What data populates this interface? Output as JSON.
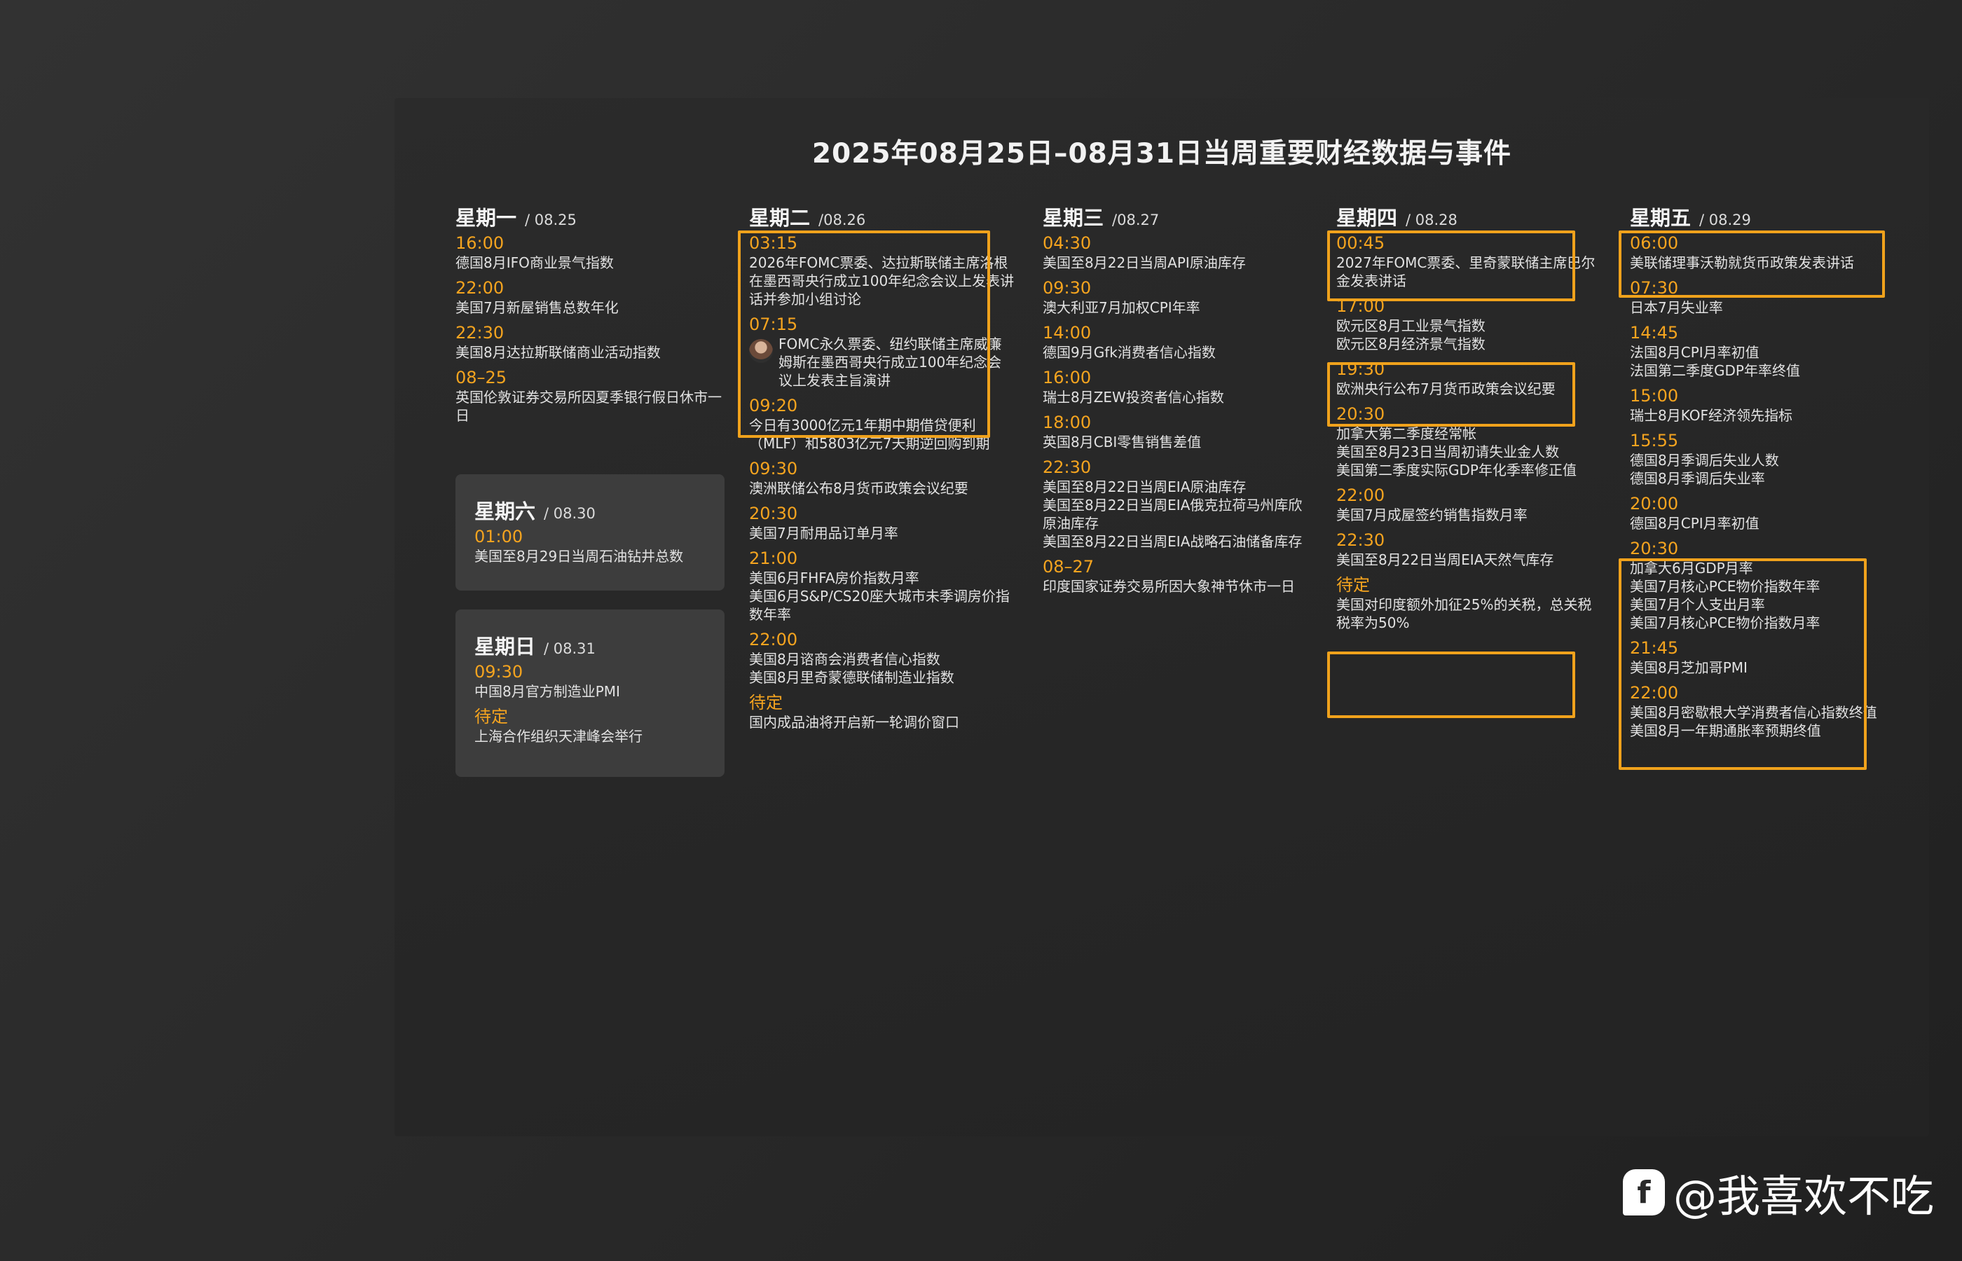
{
  "title": "2025年08月25日–08月31日当周重要财经数据与事件",
  "accent_color": "#f5a41f",
  "box_color": "#f0a21c",
  "days": {
    "mon": {
      "name": "星期一",
      "date": "/ 08.25",
      "events": [
        {
          "time": "16:00",
          "desc": [
            "德国8月IFO商业景气指数"
          ]
        },
        {
          "time": "22:00",
          "desc": [
            "美国7月新屋销售总数年化"
          ]
        },
        {
          "time": "22:30",
          "desc": [
            "美国8月达拉斯联储商业活动指数"
          ]
        },
        {
          "time": "08–25",
          "desc": [
            "英国伦敦证券交易所因夏季银行假日休市一日"
          ]
        }
      ]
    },
    "tue": {
      "name": "星期二",
      "date": "/08.26",
      "events": [
        {
          "time": "03:15",
          "desc": [
            "2026年FOMC票委、达拉斯联储主席洛根在墨西哥央行成立100年纪念会议上发表讲话并参加小组讨论"
          ]
        },
        {
          "time": "07:15",
          "desc": [
            "FOMC永久票委、纽约联储主席威廉姆斯在墨西哥央行成立100年纪念会议上发表主旨演讲"
          ]
        },
        {
          "time": "09:20",
          "desc": [
            "今日有3000亿元1年期中期借贷便利（MLF）和5803亿元7天期逆回购到期"
          ]
        },
        {
          "time": "09:30",
          "desc": [
            "澳洲联储公布8月货币政策会议纪要"
          ]
        },
        {
          "time": "20:30",
          "desc": [
            "美国7月耐用品订单月率"
          ]
        },
        {
          "time": "21:00",
          "desc": [
            "美国6月FHFA房价指数月率",
            "美国6月S&P/CS20座大城市未季调房价指数年率"
          ]
        },
        {
          "time": "22:00",
          "desc": [
            "美国8月谘商会消费者信心指数",
            "美国8月里奇蒙德联储制造业指数"
          ]
        },
        {
          "time": "待定",
          "desc": [
            "国内成品油将开启新一轮调价窗口"
          ]
        }
      ]
    },
    "wed": {
      "name": "星期三",
      "date": "/08.27",
      "events": [
        {
          "time": "04:30",
          "desc": [
            "美国至8月22日当周API原油库存"
          ]
        },
        {
          "time": "09:30",
          "desc": [
            "澳大利亚7月加权CPI年率"
          ]
        },
        {
          "time": "14:00",
          "desc": [
            "德国9月Gfk消费者信心指数"
          ]
        },
        {
          "time": "16:00",
          "desc": [
            "瑞士8月ZEW投资者信心指数"
          ]
        },
        {
          "time": "18:00",
          "desc": [
            "英国8月CBI零售销售差值"
          ]
        },
        {
          "time": "22:30",
          "desc": [
            "美国至8月22日当周EIA原油库存",
            "美国至8月22日当周EIA俄克拉荷马州库欣原油库存",
            "美国至8月22日当周EIA战略石油储备库存"
          ]
        },
        {
          "time": "08–27",
          "desc": [
            "印度国家证券交易所因大象神节休市一日"
          ]
        }
      ]
    },
    "thu": {
      "name": "星期四",
      "date": "/ 08.28",
      "events": [
        {
          "time": "00:45",
          "desc": [
            "2027年FOMC票委、里奇蒙联储主席巴尔金发表讲话"
          ]
        },
        {
          "time": "17:00",
          "desc": [
            "欧元区8月工业景气指数",
            "欧元区8月经济景气指数"
          ]
        },
        {
          "time": "19:30",
          "desc": [
            "欧洲央行公布7月货币政策会议纪要"
          ]
        },
        {
          "time": "20:30",
          "desc": [
            "加拿大第二季度经常帐",
            "美国至8月23日当周初请失业金人数",
            "美国第二季度实际GDP年化季率修正值"
          ]
        },
        {
          "time": "22:00",
          "desc": [
            "美国7月成屋签约销售指数月率"
          ]
        },
        {
          "time": "22:30",
          "desc": [
            "美国至8月22日当周EIA天然气库存"
          ]
        },
        {
          "time": "待定",
          "desc": [
            "美国对印度额外加征25%的关税，总关税税率为50%"
          ]
        }
      ]
    },
    "fri": {
      "name": "星期五",
      "date": "/ 08.29",
      "events": [
        {
          "time": "06:00",
          "desc": [
            "美联储理事沃勒就货币政策发表讲话"
          ]
        },
        {
          "time": "07:30",
          "desc": [
            "日本7月失业率"
          ]
        },
        {
          "time": "14:45",
          "desc": [
            "法国8月CPI月率初值",
            "法国第二季度GDP年率终值"
          ]
        },
        {
          "time": "15:00",
          "desc": [
            "瑞士8月KOF经济领先指标"
          ]
        },
        {
          "time": "15:55",
          "desc": [
            "德国8月季调后失业人数",
            "德国8月季调后失业率"
          ]
        },
        {
          "time": "20:00",
          "desc": [
            "德国8月CPI月率初值"
          ]
        },
        {
          "time": "20:30",
          "desc": [
            "加拿大6月GDP月率",
            "美国7月核心PCE物价指数年率",
            "美国7月个人支出月率",
            "美国7月核心PCE物价指数月率"
          ]
        },
        {
          "time": "21:45",
          "desc": [
            "美国8月芝加哥PMI"
          ]
        },
        {
          "time": "22:00",
          "desc": [
            "美国8月密歇根大学消费者信心指数终值",
            "美国8月一年期通胀率预期终值"
          ]
        }
      ]
    },
    "sat": {
      "name": "星期六",
      "date": "/ 08.30",
      "events": [
        {
          "time": "01:00",
          "desc": [
            "美国至8月29日当周石油钻井总数"
          ]
        }
      ]
    },
    "sun": {
      "name": "星期日",
      "date": "/ 08.31",
      "events": [
        {
          "time": "09:30",
          "desc": [
            "中国8月官方制造业PMI"
          ]
        },
        {
          "time": "待定",
          "desc": [
            "上海合作组织天津峰会举行"
          ]
        }
      ]
    }
  },
  "watermark": {
    "logo": "f",
    "handle": "@我喜欢不吃"
  }
}
